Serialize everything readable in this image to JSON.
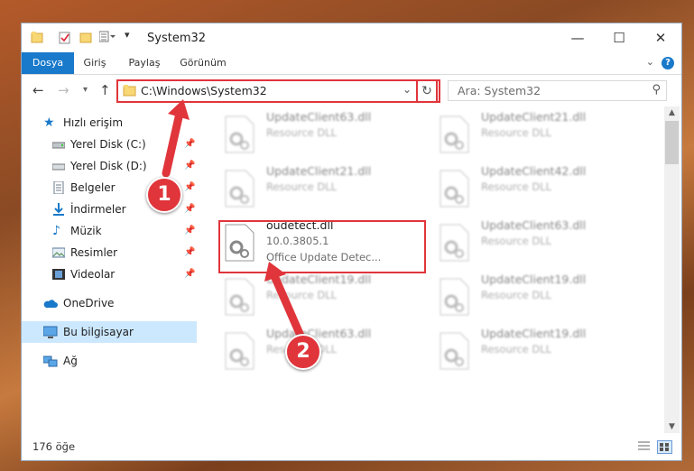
{
  "window": {
    "title": "System32",
    "min_label": "—",
    "max_label": "☐",
    "close_label": "✕"
  },
  "ribbon": {
    "tabs": [
      {
        "label": "Dosya",
        "active": true
      },
      {
        "label": "Giriş"
      },
      {
        "label": "Paylaş"
      },
      {
        "label": "Görünüm"
      }
    ],
    "help_label": "?"
  },
  "address": {
    "path": "C:\\Windows\\System32",
    "search_placeholder": "Ara: System32"
  },
  "sidebar": {
    "items": [
      {
        "label": "Hızlı erişim",
        "icon": "star-icon"
      },
      {
        "label": "Yerel Disk (C:)",
        "icon": "drive-icon",
        "pinned": true
      },
      {
        "label": "Yerel Disk (D:)",
        "icon": "drive-icon",
        "pinned": true
      },
      {
        "label": "Belgeler",
        "icon": "documents-icon",
        "pinned": true
      },
      {
        "label": "İndirmeler",
        "icon": "download-icon",
        "pinned": true
      },
      {
        "label": "Müzik",
        "icon": "music-icon",
        "pinned": true
      },
      {
        "label": "Resimler",
        "icon": "pictures-icon",
        "pinned": true
      },
      {
        "label": "Videolar",
        "icon": "videos-icon",
        "pinned": true
      },
      {
        "label": "OneDrive",
        "icon": "cloud-icon"
      },
      {
        "label": "Bu bilgisayar",
        "icon": "computer-icon",
        "selected": true
      },
      {
        "label": "Ağ",
        "icon": "network-icon"
      }
    ]
  },
  "files": [
    {
      "name": "UpdateClient63.dll",
      "line2": "Resource DLL",
      "line3": "",
      "blurred": true
    },
    {
      "name": "UpdateClient21.dll",
      "line2": "Resource DLL",
      "line3": "",
      "blurred": true
    },
    {
      "name": "UpdateClient21.dll",
      "line2": "Resource DLL",
      "line3": "",
      "blurred": true
    },
    {
      "name": "UpdateClient42.dll",
      "line2": "Resource DLL",
      "line3": "",
      "blurred": true
    },
    {
      "name": "oudetect.dll",
      "line2": "10.0.3805.1",
      "line3": "Office Update Detec...",
      "blurred": false
    },
    {
      "name": "UpdateClient63.dll",
      "line2": "Resource DLL",
      "line3": "",
      "blurred": true
    },
    {
      "name": "UpdateClient19.dll",
      "line2": "Resource DLL",
      "line3": "",
      "blurred": true
    },
    {
      "name": "UpdateClient19.dll",
      "line2": "Resource DLL",
      "line3": "",
      "blurred": true
    },
    {
      "name": "UpdateClient63.dll",
      "line2": "Resource DLL",
      "line3": "",
      "blurred": true
    },
    {
      "name": "UpdateClient19.dll",
      "line2": "Resource DLL",
      "line3": "",
      "blurred": true
    }
  ],
  "status": {
    "count": "176 öğe"
  },
  "annotations": {
    "badge1": "1",
    "badge2": "2"
  },
  "colors": {
    "accent": "#1979ca",
    "highlight": "#e0353b",
    "selected": "#cce8ff"
  }
}
